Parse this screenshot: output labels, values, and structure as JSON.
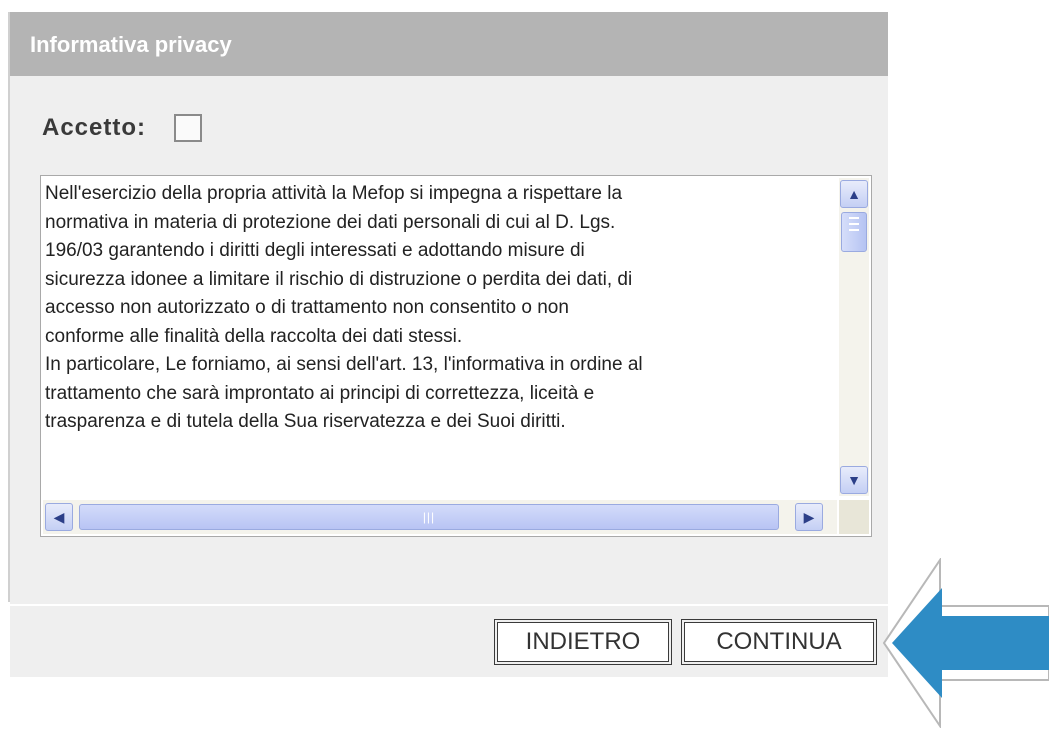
{
  "header": {
    "title": "Informativa privacy"
  },
  "accept": {
    "label": "Accetto:",
    "checked": false
  },
  "privacy_text": "Nell'esercizio della propria attività la Mefop si impegna a rispettare la\nnormativa in materia di protezione dei dati personali di cui al D. Lgs.\n196/03 garantendo i diritti degli interessati e adottando misure di\nsicurezza idonee a limitare il rischio di distruzione o perdita dei dati, di\naccesso non autorizzato o di trattamento non consentito o non\nconforme alle finalità della raccolta dei dati stessi.\nIn particolare, Le forniamo, ai sensi dell'art. 13, l'informativa in ordine al\ntrattamento che sarà improntato ai principi di correttezza, liceità e\ntrasparenza e di tutela della Sua riservatezza e dei Suoi diritti.",
  "buttons": {
    "back": "INDIETRO",
    "continue": "CONTINUA"
  },
  "colors": {
    "header_bg": "#b4b4b4",
    "panel_bg": "#efefef",
    "arrow": "#2e8cc5"
  }
}
